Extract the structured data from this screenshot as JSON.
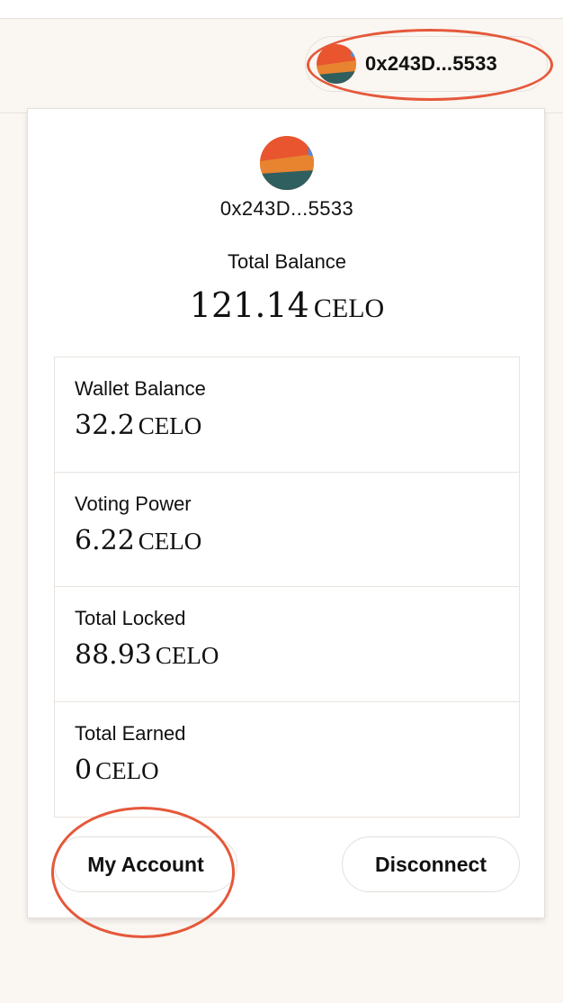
{
  "header": {
    "account_address": "0x243D...5533"
  },
  "card": {
    "address": "0x243D...5533",
    "total_balance_label": "Total Balance",
    "total_balance_value": "121.14",
    "total_balance_unit": "CELO",
    "stats": [
      {
        "label": "Wallet Balance",
        "value": "32.2",
        "unit": "CELO"
      },
      {
        "label": "Voting Power",
        "value": "6.22",
        "unit": "CELO"
      },
      {
        "label": "Total Locked",
        "value": "88.93",
        "unit": "CELO"
      },
      {
        "label": "Total Earned",
        "value": "0",
        "unit": "CELO"
      }
    ],
    "my_account_label": "My Account",
    "disconnect_label": "Disconnect"
  },
  "icons": {
    "avatar": "identicon-avatar"
  },
  "colors": {
    "annotation": "#e5583a",
    "avatar_top": "#e8552e",
    "avatar_mid": "#e8832f",
    "avatar_bottom": "#2f5f5f",
    "avatar_accent": "#4a8fe0",
    "background": "#faf6f1"
  }
}
